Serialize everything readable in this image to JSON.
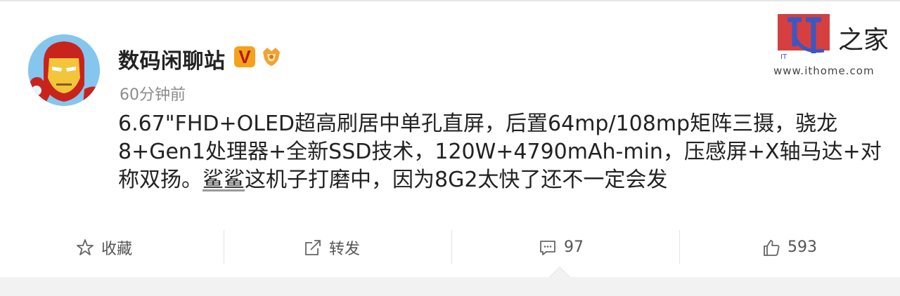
{
  "post": {
    "author": "数码闲聊站",
    "verified_badge": "V",
    "time": "60分钟前",
    "text_lines": [
      "6.67\"FHD+OLED超高刷居中单孔直屏，后置64mp/108mp矩阵三摄，骁龙",
      "8+Gen1处理器+全新SSD技术，120W+4790mAh-min，压感屏+X轴马达+对"
    ],
    "text_line3_prefix": "称双扬。",
    "mention": "鲨鲨",
    "text_line3_suffix": "这机子打磨中，因为8G2太快了还不一定会发"
  },
  "watermark": {
    "logo_text": "IT",
    "chars": "之家",
    "url": "www.ithome.com"
  },
  "actions": {
    "favorite_label": "收藏",
    "repost_label": "转发",
    "comment_count": "97",
    "like_count": "593"
  },
  "colors": {
    "verified": "#f4a21c",
    "watermark_red": "#d32f2f"
  },
  "icons": [
    "star-icon",
    "repost-icon",
    "comment-icon",
    "thumbs-up-icon"
  ]
}
